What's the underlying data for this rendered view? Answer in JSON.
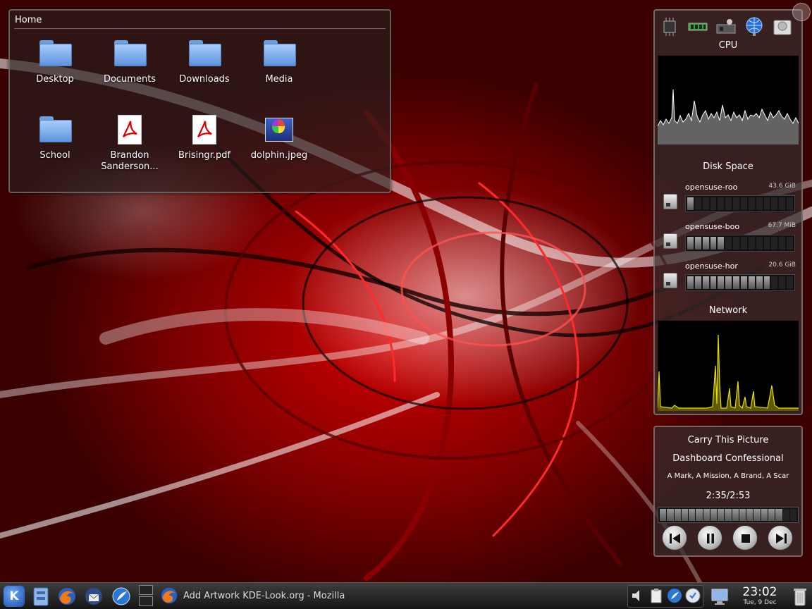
{
  "folderview": {
    "title": "Home",
    "items": [
      {
        "label": "Desktop",
        "icon": "folder-icon"
      },
      {
        "label": "Documents",
        "icon": "folder-icon"
      },
      {
        "label": "Downloads",
        "icon": "folder-icon"
      },
      {
        "label": "Media",
        "icon": "folder-icon"
      },
      {
        "label": "School",
        "icon": "folder-icon"
      },
      {
        "label": "Brandon Sanderson...",
        "icon": "pdf-file-icon"
      },
      {
        "label": "Brisingr.pdf",
        "icon": "pdf-file-icon"
      },
      {
        "label": "dolphin.jpeg",
        "icon": "image-file-icon"
      }
    ]
  },
  "sysmon": {
    "cpu_title": "CPU",
    "disk_title": "Disk Space",
    "network_title": "Network",
    "disks": [
      {
        "name": "opensuse-roo",
        "size": "43.6 GiB",
        "used_fraction": 0.1
      },
      {
        "name": "opensuse-boo",
        "size": "67.7 MiB",
        "used_fraction": 0.35
      },
      {
        "name": "opensuse-hor",
        "size": "20.6 GiB",
        "used_fraction": 0.75
      }
    ]
  },
  "nowplaying": {
    "title": "Carry This Picture",
    "artist": "Dashboard Confessional",
    "album": "A Mark, A Mission, A Brand, A Scar",
    "time": "2:35/2:53",
    "progress_fraction": 0.895
  },
  "panel": {
    "kmenu_label": "K",
    "task_label": "Add Artwork KDE-Look.org - Mozilla",
    "clock_time": "23:02",
    "clock_date": "Tue, 9 Dec"
  },
  "colors": {
    "wallpaper_red": "#c00000",
    "network_line": "#e8e000"
  }
}
